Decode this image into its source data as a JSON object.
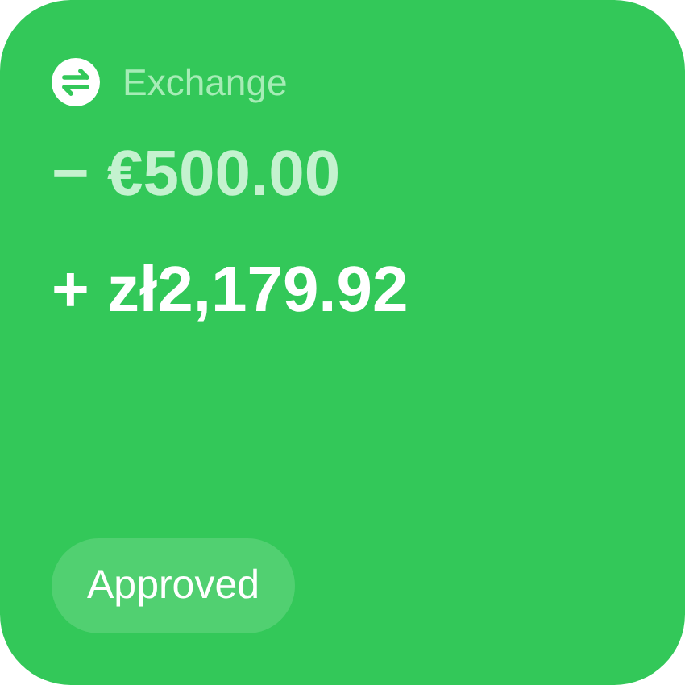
{
  "header": {
    "title": "Exchange"
  },
  "amounts": [
    {
      "kind": "debit",
      "text": "− €500.00"
    },
    {
      "kind": "credit",
      "text": "+ zł2,179.92"
    }
  ],
  "status": {
    "label": "Approved"
  }
}
